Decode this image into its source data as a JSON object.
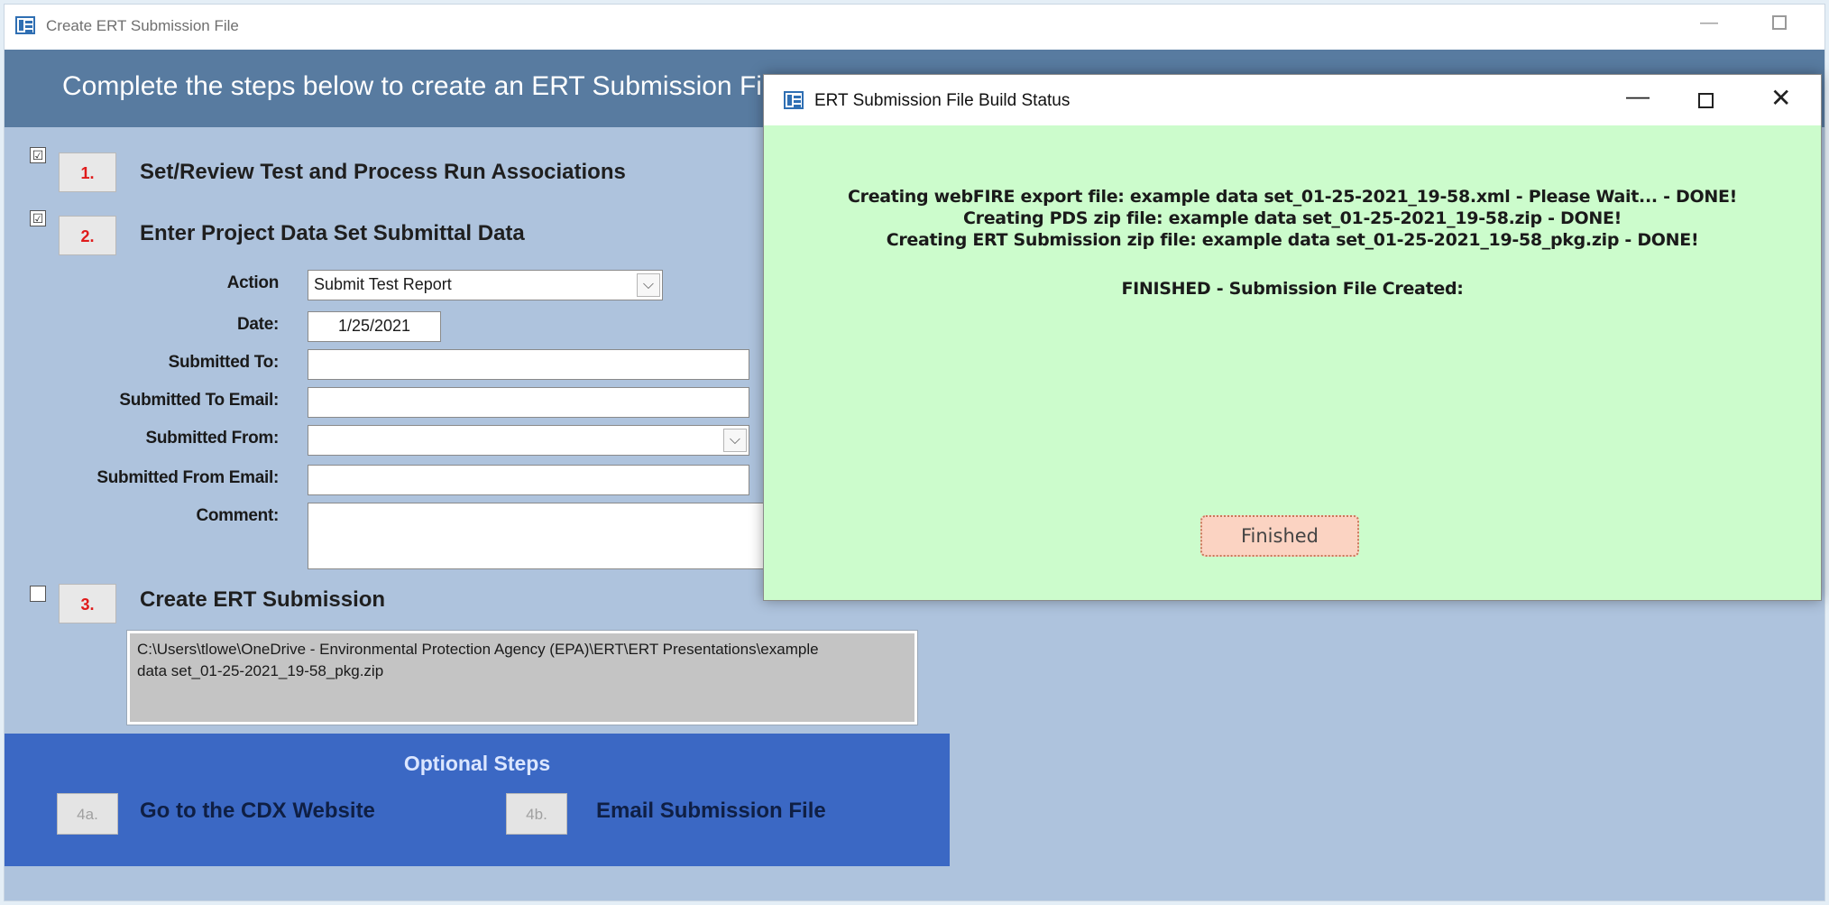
{
  "main_window": {
    "title": "Create ERT Submission File",
    "header": "Complete the steps below to create an ERT Submission File"
  },
  "steps": [
    {
      "number": "1.",
      "label": "Set/Review Test and Process Run Associations",
      "checked": true,
      "check_mark": "☑"
    },
    {
      "number": "2.",
      "label": "Enter Project Data Set Submittal Data",
      "checked": true,
      "check_mark": "☑"
    },
    {
      "number": "3.",
      "label": "Create ERT Submission",
      "checked": false,
      "check_mark": ""
    }
  ],
  "form": {
    "action_label": "Action",
    "action_value": "Submit Test Report",
    "date_label": "Date:",
    "date_value": "1/25/2021",
    "submitted_to_label": "Submitted To:",
    "submitted_to_value": "",
    "submitted_to_email_label": "Submitted To Email:",
    "submitted_to_email_value": "",
    "submitted_from_label": "Submitted From:",
    "submitted_from_value": "",
    "submitted_from_email_label": "Submitted From Email:",
    "submitted_from_email_value": "",
    "comment_label": "Comment:",
    "comment_value": ""
  },
  "output_path": {
    "line1": "C:\\Users\\tlowe\\OneDrive - Environmental Protection Agency (EPA)\\ERT\\ERT Presentations\\example",
    "line2": "data set_01-25-2021_19-58_pkg.zip"
  },
  "optional": {
    "title": "Optional Steps",
    "step_4a_number": "4a.",
    "step_4a_label": "Go to the CDX Website",
    "step_4b_number": "4b.",
    "step_4b_label": "Email Submission File"
  },
  "dialog": {
    "title": "ERT Submission File Build Status",
    "messages": [
      "Creating webFIRE export file: example data set_01-25-2021_19-58.xml - Please Wait... - DONE!",
      "Creating PDS zip file: example data set_01-25-2021_19-58.zip - DONE!",
      "Creating ERT Submission zip file: example data set_01-25-2021_19-58_pkg.zip - DONE!"
    ],
    "status": "FINISHED - Submission File Created:",
    "button_label": "Finished"
  },
  "icons": {
    "app": "access-form-icon",
    "minimize": "minimize-icon",
    "maximize": "maximize-icon",
    "close": "close-icon",
    "dropdown": "chevron-down-icon"
  },
  "colors": {
    "main_background": "#aec3dd",
    "header_banner": "#587ba0",
    "optional_panel": "#3b68c4",
    "dialog_background": "#ccfccc",
    "step_number": "#e01b1b",
    "finished_button": "#fbd3c2"
  }
}
